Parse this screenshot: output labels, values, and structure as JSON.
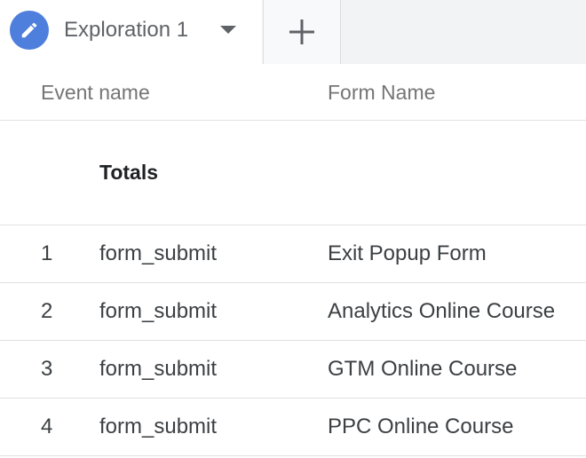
{
  "tabs": {
    "active_title": "Exploration 1",
    "add_label": "+"
  },
  "table": {
    "columns": [
      "Event name",
      "Form Name"
    ],
    "totals_label": "Totals",
    "rows": [
      {
        "index": "1",
        "event": "form_submit",
        "form": "Exit Popup Form"
      },
      {
        "index": "2",
        "event": "form_submit",
        "form": "Analytics Online Course"
      },
      {
        "index": "3",
        "event": "form_submit",
        "form": "GTM Online Course"
      },
      {
        "index": "4",
        "event": "form_submit",
        "form": "PPC Online Course"
      }
    ]
  },
  "colors": {
    "accent": "#4f7fdc",
    "tabbar_bg": "#f1f3f4",
    "divider": "#e0e0e0"
  },
  "icons": {
    "tab_icon": "pencil-icon",
    "tab_menu": "caret-down-icon",
    "add_tab": "plus-icon"
  }
}
